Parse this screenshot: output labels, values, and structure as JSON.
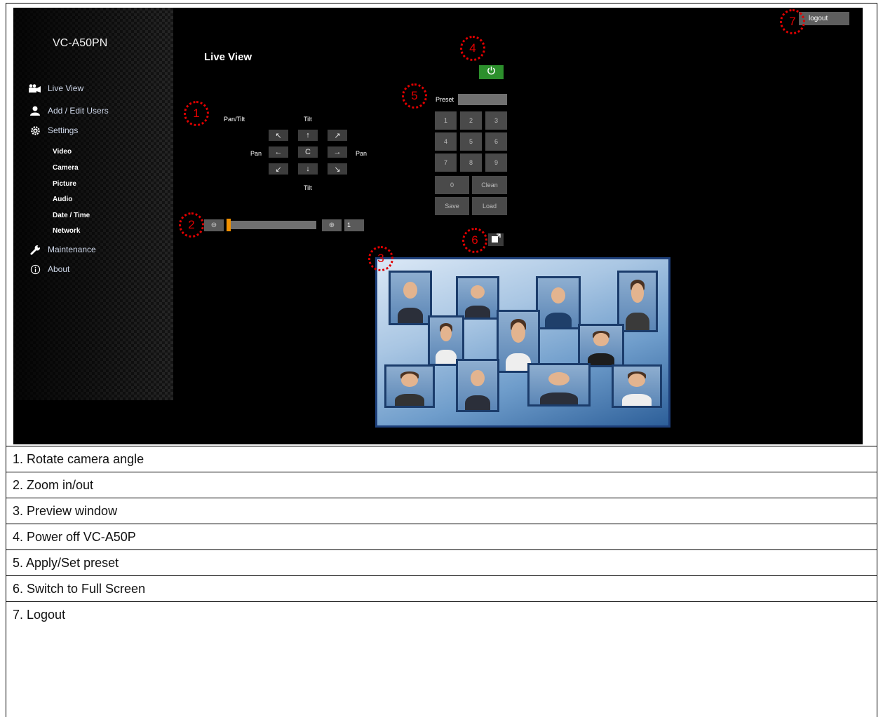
{
  "app": {
    "model": "VC-A50PN",
    "page_title": "Live View",
    "logout_label": "logout"
  },
  "sidebar": {
    "items": [
      {
        "label": "Live View",
        "icon": "camera-icon"
      },
      {
        "label": "Add / Edit Users",
        "icon": "user-icon"
      },
      {
        "label": "Settings",
        "icon": "gear-icon"
      },
      {
        "label": "Maintenance",
        "icon": "wrench-icon"
      },
      {
        "label": "About",
        "icon": "info-icon"
      }
    ],
    "settings_sub": [
      "Video",
      "Camera",
      "Picture",
      "Audio",
      "Date / Time",
      "Network"
    ]
  },
  "ptz": {
    "pan_tilt_label": "Pan/Tilt",
    "tilt_top": "Tilt",
    "tilt_bottom": "Tilt",
    "pan_left": "Pan",
    "pan_right": "Pan",
    "arrows": {
      "up_left": "↖",
      "up": "↑",
      "up_right": "↗",
      "left": "←",
      "home": "C",
      "right": "→",
      "down_left": "↙",
      "down": "↓",
      "down_right": "↘"
    }
  },
  "zoom": {
    "zoom_out_icon": "⊖",
    "zoom_in_icon": "⊕",
    "value": "1",
    "level_fraction": 0
  },
  "preset": {
    "label": "Preset",
    "keys": [
      "1",
      "2",
      "3",
      "4",
      "5",
      "6",
      "7",
      "8",
      "9"
    ],
    "zero": "0",
    "clean": "Clean",
    "save": "Save",
    "load": "Load"
  },
  "markers": [
    "1",
    "2",
    "3",
    "4",
    "5",
    "6",
    "7"
  ],
  "legend": [
    "1. Rotate camera angle",
    "2. Zoom in/out",
    "3. Preview window",
    "4. Power off VC-A50P",
    "5. Apply/Set preset",
    "6. Switch to Full Screen",
    "7. Logout"
  ],
  "colors": {
    "accent_orange": "#f39200",
    "power_green": "#2c8f2c",
    "marker_red": "#e00000"
  }
}
